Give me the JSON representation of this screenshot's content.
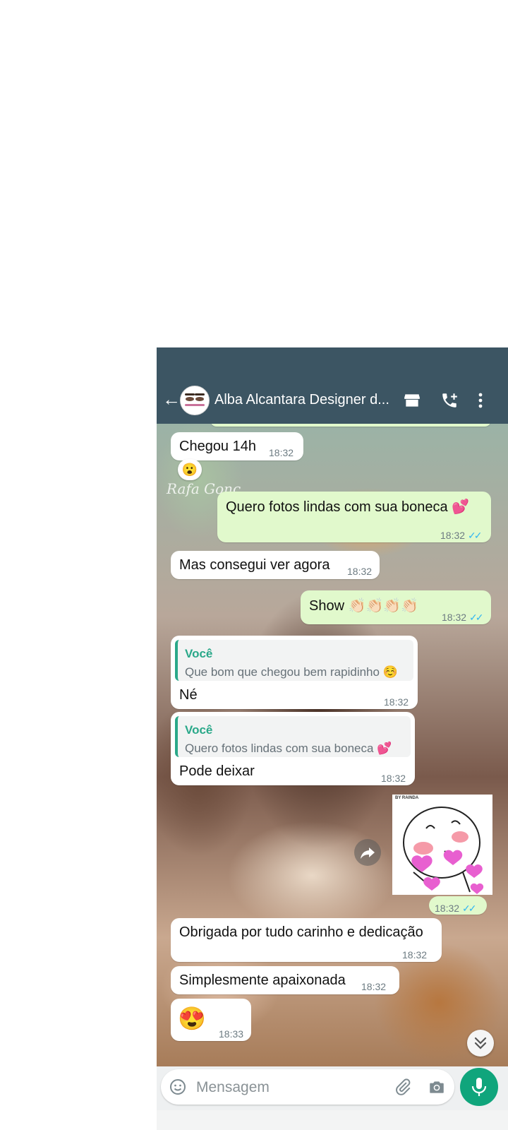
{
  "header": {
    "title": "Alba Alcantara Designer d...",
    "back_icon": "arrow-left-icon",
    "icons": [
      "store-icon",
      "add-call-icon",
      "more-vert-icon"
    ]
  },
  "colors": {
    "header_bg": "#3c5563",
    "outgoing_bubble": "#e1f9cc",
    "incoming_bubble": "#ffffff",
    "quote_accent": "#2aa889",
    "read_ticks": "#34b7f1",
    "mic_button": "#10a57c"
  },
  "messages": [
    {
      "dir": "in",
      "text": "Chegou 14h",
      "time": "18:32",
      "reaction": "😮"
    },
    {
      "dir": "out",
      "text": "Quero fotos lindas com sua boneca 💕",
      "time": "18:32",
      "ticks": "✓✓"
    },
    {
      "dir": "in",
      "text": "Mas consegui ver agora",
      "time": "18:32"
    },
    {
      "dir": "out",
      "text": "Show 👏🏻👏🏻👏🏻👏🏻",
      "time": "18:32",
      "ticks": "✓✓"
    },
    {
      "dir": "in",
      "quote_author": "Você",
      "quote_text": "Que bom que chegou bem rapidinho ☺️",
      "text": "Né",
      "time": "18:32"
    },
    {
      "dir": "in",
      "quote_author": "Você",
      "quote_text": "Quero fotos lindas com sua boneca 💕",
      "text": "Pode deixar",
      "time": "18:32"
    },
    {
      "dir": "out",
      "type": "sticker",
      "sticker_caption": "BY RAINDA",
      "time": "18:32",
      "ticks": "✓✓"
    },
    {
      "dir": "in",
      "text": "Obrigada por tudo carinho e dedicação",
      "time": "18:32"
    },
    {
      "dir": "in",
      "text": "Simplesmente apaixonada",
      "time": "18:32"
    },
    {
      "dir": "in",
      "text": "😍",
      "time": "18:33"
    }
  ],
  "watermark": "Rafa Gonç...",
  "composer": {
    "placeholder": "Mensagem",
    "icons": [
      "emoji-icon",
      "attach-icon",
      "camera-icon",
      "mic-icon"
    ]
  }
}
